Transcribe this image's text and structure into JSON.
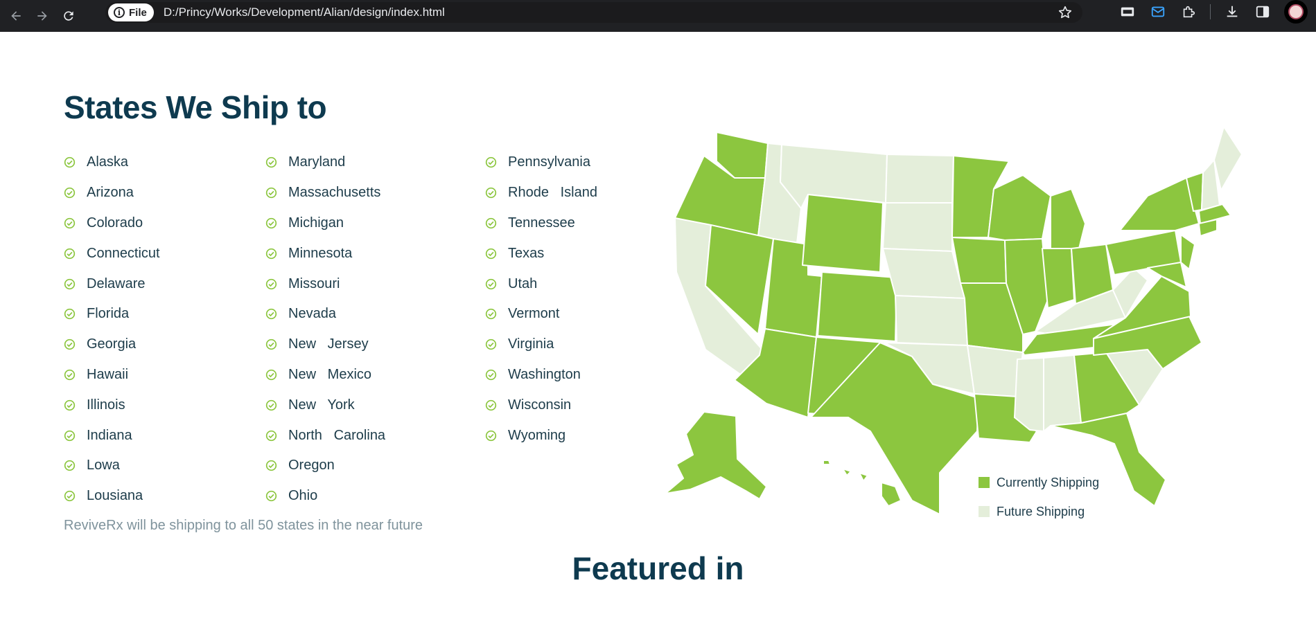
{
  "browser": {
    "file_label": "File",
    "url": "D:/Princy/Works/Development/Alian/design/index.html"
  },
  "section": {
    "title": "States We Ship to",
    "columns": [
      [
        "Alaska",
        "Arizona",
        "Colorado",
        "Connecticut",
        "Delaware",
        "Florida",
        "Georgia",
        "Hawaii",
        "Illinois",
        "Indiana",
        "Lowa",
        "Lousiana"
      ],
      [
        "Maryland",
        "Massachusetts",
        "Michigan",
        "Minnesota",
        "Missouri",
        "Nevada",
        "New   Jersey",
        "New   Mexico",
        "New   York",
        "North   Carolina",
        "Oregon",
        "Ohio"
      ],
      [
        "Pennsylvania",
        "Rhode   Island",
        "Tennessee",
        "Texas",
        "Utah",
        "Vermont",
        "Virginia",
        "Washington",
        "Wisconsin",
        "Wyoming"
      ]
    ],
    "footnote": "ReviveRx will be shipping to all 50 states in the near future"
  },
  "legend": {
    "current_label": "Currently Shipping",
    "future_label": "Future Shipping"
  },
  "colors": {
    "current": "#8cc63f",
    "future": "#e4eeda",
    "heading": "#0e3a4f"
  },
  "featured": {
    "title": "Featured in"
  }
}
